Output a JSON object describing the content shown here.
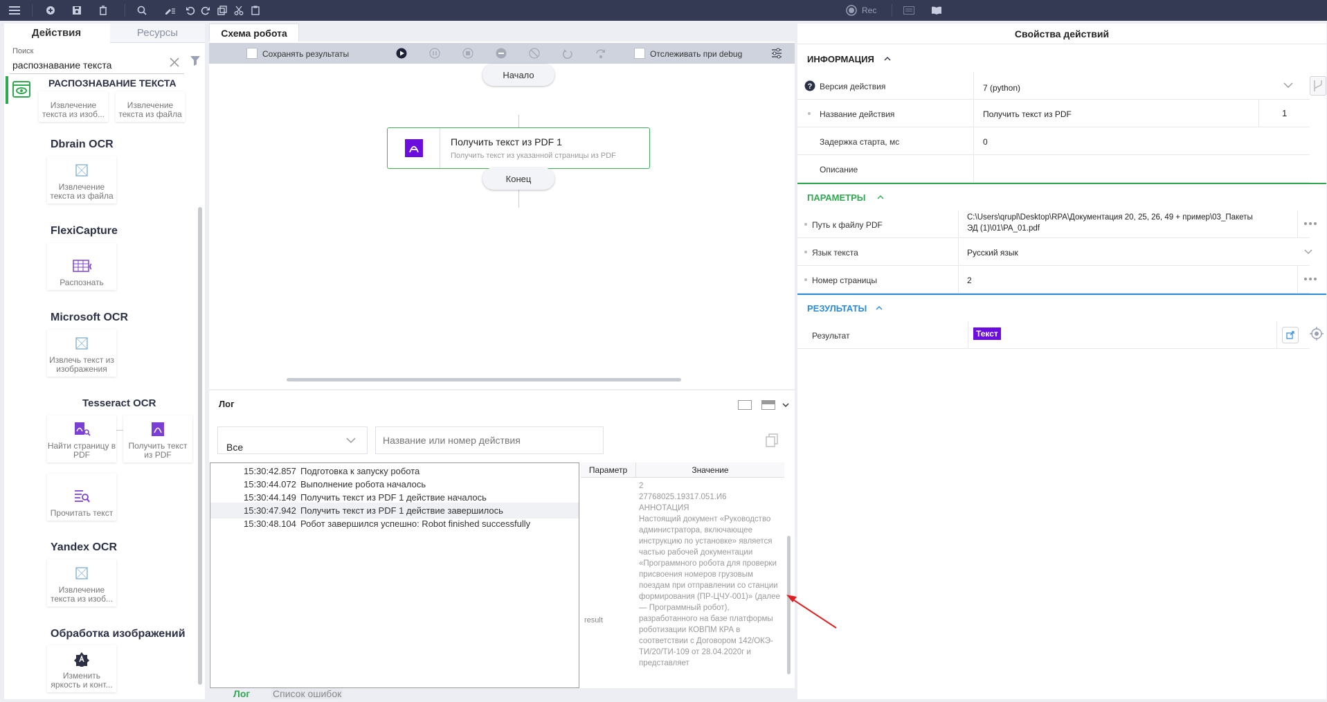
{
  "toolbar": {
    "rec_label": "Rec",
    "icons": [
      "menu-icon",
      "add-icon",
      "save-icon",
      "trash-icon",
      "search-icon",
      "edit-list-icon",
      "undo-icon",
      "redo-icon",
      "copy-icon",
      "cut-icon",
      "paste-icon",
      "record-icon",
      "keyboard-icon",
      "book-icon"
    ]
  },
  "left_panel": {
    "tab_actions": "Действия",
    "tab_resources": "Ресурсы",
    "search_label": "Поиск",
    "search_value": "распознавание текста",
    "category_title": "РАСПОЗНАВАНИЕ ТЕКСТА",
    "groups": [
      {
        "name": "",
        "tiles": [
          "Извлечение текста из изоб...",
          "Извлечение текста из файла"
        ]
      },
      {
        "name": "Dbrain OCR",
        "tiles": [
          "Извлечение текста из файла"
        ]
      },
      {
        "name": "FlexiCapture",
        "tiles": [
          "Распознать"
        ]
      },
      {
        "name": "Microsoft OCR",
        "tiles": [
          "Извлечь текст из изображения"
        ]
      },
      {
        "name": "Tesseract OCR",
        "tiles": [
          "Найти страницу в PDF",
          "Получить текст из PDF",
          "Прочитать текст"
        ]
      },
      {
        "name": "Yandex OCR",
        "tiles": [
          "Извлечение текста из изоб..."
        ]
      },
      {
        "name": "Обработка изображений",
        "tiles": [
          "Изменить яркость и конт..."
        ]
      }
    ]
  },
  "schema": {
    "tab": "Схема робота",
    "save_results": "Сохранять результаты",
    "track_debug": "Отслеживать при debug",
    "start_label": "Начало",
    "end_label": "Конец",
    "node_title": "Получить текст из PDF  1",
    "node_subtitle": "Получить текст из указанной страницы из PDF"
  },
  "log": {
    "title": "Лог",
    "filter_value": "Все",
    "search_placeholder": "Название или номер действия",
    "rows": [
      {
        "time": "15:30:42.857",
        "msg": "Подготовка к запуску робота"
      },
      {
        "time": "15:30:44.072",
        "msg": "Выполнение робота началось"
      },
      {
        "time": "15:30:44.149",
        "msg": "Получить текст из PDF 1 действие началось"
      },
      {
        "time": "15:30:47.942",
        "msg": "Получить текст из PDF 1 действие завершилось"
      },
      {
        "time": "15:30:48.104",
        "msg": "Робот завершился успешно: Robot finished successfully"
      }
    ],
    "detail_header_param": "Параметр",
    "detail_header_value": "Значение",
    "detail_param": "result",
    "detail_value": "2\n27768025.19317.051.И6\nАННОТАЦИЯ\nНастоящий документ «Руководство администратора, включающее инструкцию по установке» является частью рабочей документации «Программного робота для проверки присвоения номеров грузовым поездам при отправлении со станции формирования (ПР-ЦЧУ-001)» (далее — Программный робот), разработанного на базе платформы роботизации КОВПМ КРА в\nсоответствии с Договором 142/ОКЭ-ТИ/20/ТИ-109 от 28.04.2020г и представляет",
    "tab_log": "Лог",
    "tab_errors": "Список ошибок"
  },
  "properties": {
    "title": "Свойства действий",
    "info_section": "ИНФОРМАЦИЯ",
    "params_section": "ПАРАМЕТРЫ",
    "results_section": "РЕЗУЛЬТАТЫ",
    "version_label": "Версия действия",
    "version_value": "7 (python)",
    "name_label": "Название действия",
    "name_value": "Получить текст из PDF",
    "name_number": "1",
    "delay_label": "Задержка старта, мс",
    "delay_value": "0",
    "description_label": "Описание",
    "description_value": "",
    "path_label": "Путь к файлу PDF",
    "path_value_line1": "C:\\Users\\qrupl\\Desktop\\RPA\\Документация 20, 25, 26, 49 + пример\\03_Пакеты",
    "path_value_line2": "ЭД (1)\\01\\PA_01.pdf",
    "language_label": "Язык текста",
    "language_value": "Русский язык",
    "page_label": "Номер страницы",
    "page_value": "2",
    "result_label": "Результат",
    "result_badge": "Текст"
  },
  "colors": {
    "accent_green": "#2fa84f",
    "purple": "#6a0dde",
    "topbar": "#343a54",
    "arrow": "#e02020"
  }
}
